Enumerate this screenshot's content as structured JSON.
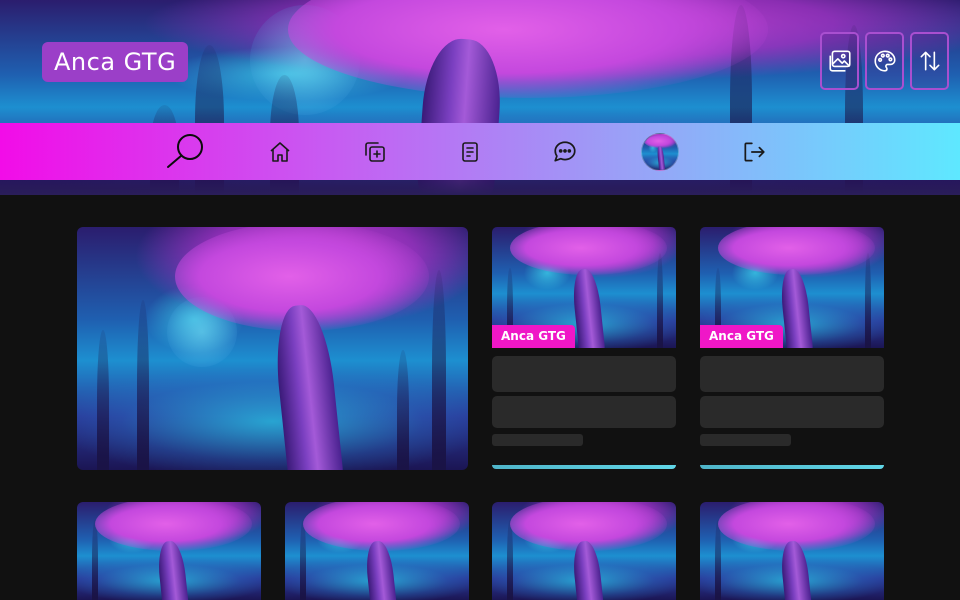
{
  "brand": {
    "title": "Anca GTG"
  },
  "top_actions": [
    {
      "name": "gallery-icon"
    },
    {
      "name": "palette-icon"
    },
    {
      "name": "sort-icon"
    }
  ],
  "nav": {
    "items": [
      {
        "name": "search-icon"
      },
      {
        "name": "home-icon"
      },
      {
        "name": "add-collection-icon"
      },
      {
        "name": "document-icon"
      },
      {
        "name": "chat-icon"
      },
      {
        "name": "profile-avatar"
      },
      {
        "name": "logout-icon"
      }
    ],
    "gradient": [
      "#f20ce8",
      "#c65df2",
      "#9aa0f7",
      "#5ee8ff"
    ]
  },
  "featured": {
    "image": "fantasy-tree-artwork"
  },
  "cards": [
    {
      "tag": "Anca GTG"
    },
    {
      "tag": "Anca GTG"
    }
  ],
  "grid_cards": [
    {
      "image": "fantasy-tree-artwork"
    },
    {
      "image": "fantasy-tree-artwork"
    },
    {
      "image": "fantasy-tree-artwork"
    },
    {
      "image": "fantasy-tree-artwork"
    }
  ],
  "colors": {
    "background": "#111111",
    "brand_badge": "#9b3fc8",
    "tag": "#ef17c7",
    "skeleton": "#2a2a2a",
    "accent_underline": "#61d7e8",
    "button_border": "#a94fd0"
  }
}
